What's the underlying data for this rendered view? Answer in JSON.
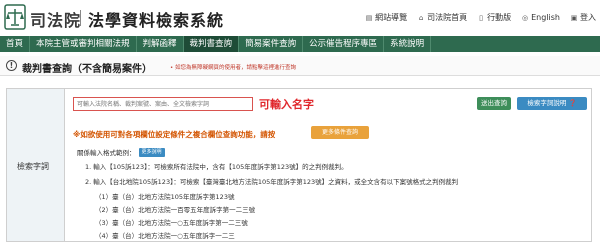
{
  "header": {
    "logo_text": "司法院",
    "site_title": "法學資料檢索系統",
    "links": [
      {
        "icon": "sitemap-icon",
        "glyph": "▤",
        "label": "網站導覽"
      },
      {
        "icon": "home-icon",
        "glyph": "⌂",
        "label": "司法院首頁"
      },
      {
        "icon": "mobile-icon",
        "glyph": "▯",
        "label": "行動版"
      },
      {
        "icon": "globe-icon",
        "glyph": "◎",
        "label": "English"
      },
      {
        "icon": "lock-icon",
        "glyph": "▣",
        "label": "登入"
      }
    ]
  },
  "nav": [
    {
      "label": "首頁",
      "active": false
    },
    {
      "label": "本院主管或審判相關法規",
      "active": false
    },
    {
      "label": "判解函釋",
      "active": false
    },
    {
      "label": "裁判書查詢",
      "active": true
    },
    {
      "label": "簡易案件查詢",
      "active": false
    },
    {
      "label": "公示催告程序專區",
      "active": false
    },
    {
      "label": "系統說明",
      "active": false
    }
  ],
  "page": {
    "title": "裁判書查詢（不含簡易案件）",
    "note": "• 如您為無障礙網頁的使用者，請點擊這裡進行查詢"
  },
  "search": {
    "row_label": "檢索字詞",
    "placeholder": "可輸入法院名稱、裁判案號、案由、全文檢索字詞",
    "annotation": "可輸入名字",
    "search_button": "送出查詢",
    "help_button": "檢索字詞說明 ❓",
    "multi_note": "※如欲使用可對各項欄位設定條件之複合欄位查詢功能，請按",
    "more_conditions_button": "更多條件查詢",
    "example_header": "關係輸入格式範例：",
    "more_examples_button": "更多說明",
    "examples": [
      "1. 輸入【105訴123】：可檢索所有法院中，含有【105年度訴字第123號】的之判例裁判。",
      "2. 輸入【台北地院105訴123】：可檢索【臺灣臺北地方法院105年度訴字第123號】之資料，或全文含有以下案號格式之判例裁判"
    ],
    "sub_examples": [
      "（1）臺（台）北地方法院105年度訴字第123號",
      "（2）臺（台）北地方法院一百零五年度訴字第一二三號",
      "（3）臺（台）北地方法院一○五年度訴字第一二三號",
      "（4）臺（台）北地方法院一○五年度訴字一二三"
    ]
  }
}
